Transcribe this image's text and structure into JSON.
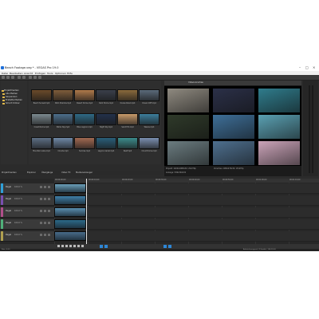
{
  "titlebar": {
    "title": "Beach Footage.veg * - VEGAS Pro 19.0"
  },
  "menu": {
    "items": [
      "Datei",
      "Bearbeiten",
      "Ansicht",
      "Einfügen",
      "Tools",
      "Optionen",
      "Hilfe"
    ]
  },
  "explorer": {
    "items": [
      "Projektmedien",
      "Alle Medien",
      "Sequenzen",
      "Erstellte Medien",
      "Smart Ordner"
    ]
  },
  "media": {
    "thumbs": [
      {
        "label": "Beach Sunset.mp4",
        "color": "#6b4a2a"
      },
      {
        "label": "Palm Shadow.mp4",
        "color": "#7f5d3b"
      },
      {
        "label": "Desert Dome.mp4",
        "color": "#b07a4a"
      },
      {
        "label": "Dark Shore.mp4",
        "color": "#3a3f4a"
      },
      {
        "label": "Dunes Road.mp4",
        "color": "#8a6a3c"
      },
      {
        "label": "Ocean Cliff.mp4",
        "color": "#5a6a7a"
      },
      {
        "label": "Coast Rocks.mp4",
        "color": "#7c8a90"
      },
      {
        "label": "Palms Sky.mp4",
        "color": "#4d6f8c"
      },
      {
        "label": "Blue Lagoon.mp4",
        "color": "#2f6a86"
      },
      {
        "label": "Night Sky.mp4",
        "color": "#23314a"
      },
      {
        "label": "Sand Hill.mp4",
        "color": "#c89a6a"
      },
      {
        "label": "Waves.mp4",
        "color": "#3c7e9c"
      },
      {
        "label": "Mountain Lake.mp4",
        "color": "#5d6f84"
      },
      {
        "label": "Clouds.mp4",
        "color": "#6f88a6"
      },
      {
        "label": "Sunrise.mp4",
        "color": "#a26a52"
      },
      {
        "label": "Lagoon Aerial.mp4",
        "color": "#2a5f7a"
      },
      {
        "label": "Reef.mp4",
        "color": "#3c8c8c"
      },
      {
        "label": "Cloud Dome.mp4",
        "color": "#7b8fb0"
      }
    ]
  },
  "preview": {
    "title": "Videovorschau",
    "tiles": [
      "#8f8a80",
      "#2b3048",
      "#2f7c8c",
      "#2f3a2a",
      "#3e6f98",
      "#5aa0b2",
      "#6b7c80",
      "#4e6f8e",
      "#caa3b8"
    ],
    "info_left": "Projekt: 1920x1080x32; 29,970p",
    "info_right": "Vorschau: 480x270x32; 29,970p",
    "display": "Anzeige: 536x302x32"
  },
  "tabs": [
    "Projektmedien",
    "Explorer",
    "Übergänge",
    "Video FX",
    "Medienerzeuger"
  ],
  "timeline": {
    "ruler": [
      "00:00:00;00",
      "00:00:10;00",
      "00:00:20;00",
      "00:00:30;00",
      "00:00:40;00",
      "00:00:50;00",
      "00:01:00;00",
      "00:01:10;00"
    ],
    "tracks": [
      {
        "num_color": "#2fa0d8",
        "name": "Pegel",
        "level": "100,0 %",
        "clip_color": "#6a9fb8"
      },
      {
        "num_color": "#7a4fb0",
        "name": "Pegel",
        "level": "100,0 %",
        "clip_color": "#3f7fa8"
      },
      {
        "num_color": "#b04f8a",
        "name": "Pegel",
        "level": "100,0 %",
        "clip_color": "#5a8fb0"
      },
      {
        "num_color": "#4fb07a",
        "name": "Pegel",
        "level": "100,0 %",
        "clip_color": "#2c6a88"
      },
      {
        "num_color": "#b0a04f",
        "name": "Pegel",
        "level": "100,0 %",
        "clip_color": "#486c8a"
      }
    ]
  },
  "status": {
    "left": "Rate: 0,00",
    "right": "Aufzeichnungszeit (2 Kanäle): 104:25:50"
  }
}
